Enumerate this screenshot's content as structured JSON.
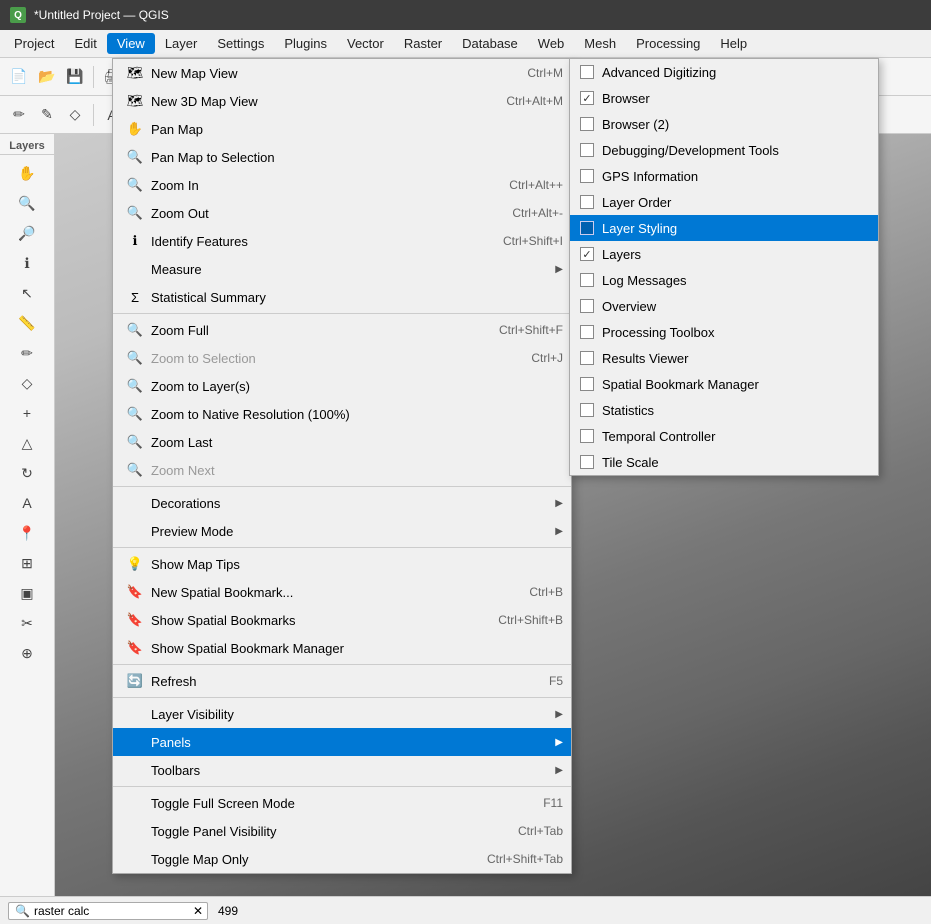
{
  "titleBar": {
    "icon": "Q",
    "title": "*Untitled Project — QGIS"
  },
  "menuBar": {
    "items": [
      {
        "id": "project",
        "label": "Project"
      },
      {
        "id": "edit",
        "label": "Edit"
      },
      {
        "id": "view",
        "label": "View",
        "active": true
      },
      {
        "id": "layer",
        "label": "Layer"
      },
      {
        "id": "settings",
        "label": "Settings"
      },
      {
        "id": "plugins",
        "label": "Plugins"
      },
      {
        "id": "vector",
        "label": "Vector"
      },
      {
        "id": "raster",
        "label": "Raster"
      },
      {
        "id": "database",
        "label": "Database"
      },
      {
        "id": "web",
        "label": "Web"
      },
      {
        "id": "mesh",
        "label": "Mesh"
      },
      {
        "id": "processing",
        "label": "Processing"
      },
      {
        "id": "help",
        "label": "Help"
      }
    ]
  },
  "viewMenu": {
    "items": [
      {
        "id": "new-map-view",
        "icon": "🗺",
        "label": "New Map View",
        "shortcut": "Ctrl+M",
        "hasArrow": false,
        "disabled": false
      },
      {
        "id": "new-3d-map-view",
        "icon": "🗺",
        "label": "New 3D Map View",
        "shortcut": "Ctrl+Alt+M",
        "hasArrow": false,
        "disabled": false
      },
      {
        "id": "pan-map",
        "icon": "✋",
        "label": "Pan Map",
        "shortcut": "",
        "hasArrow": false,
        "disabled": false
      },
      {
        "id": "pan-map-to-selection",
        "icon": "🔍",
        "label": "Pan Map to Selection",
        "shortcut": "",
        "hasArrow": false,
        "disabled": false
      },
      {
        "id": "zoom-in",
        "icon": "🔍",
        "label": "Zoom In",
        "shortcut": "Ctrl+Alt++",
        "hasArrow": false,
        "disabled": false
      },
      {
        "id": "zoom-out",
        "icon": "🔍",
        "label": "Zoom Out",
        "shortcut": "Ctrl+Alt+-",
        "hasArrow": false,
        "disabled": false
      },
      {
        "id": "identify-features",
        "icon": "ℹ",
        "label": "Identify Features",
        "shortcut": "Ctrl+Shift+I",
        "hasArrow": false,
        "disabled": false
      },
      {
        "id": "measure",
        "icon": "",
        "label": "Measure",
        "shortcut": "",
        "hasArrow": true,
        "disabled": false
      },
      {
        "id": "statistical-summary",
        "icon": "Σ",
        "label": "Statistical Summary",
        "shortcut": "",
        "hasArrow": false,
        "disabled": false
      },
      {
        "id": "sep1",
        "type": "separator"
      },
      {
        "id": "zoom-full",
        "icon": "🔍",
        "label": "Zoom Full",
        "shortcut": "Ctrl+Shift+F",
        "hasArrow": false,
        "disabled": false
      },
      {
        "id": "zoom-to-selection",
        "icon": "🔍",
        "label": "Zoom to Selection",
        "shortcut": "Ctrl+J",
        "hasArrow": false,
        "disabled": true
      },
      {
        "id": "zoom-to-layers",
        "icon": "🔍",
        "label": "Zoom to Layer(s)",
        "shortcut": "",
        "hasArrow": false,
        "disabled": false
      },
      {
        "id": "zoom-to-native",
        "icon": "🔍",
        "label": "Zoom to Native Resolution (100%)",
        "shortcut": "",
        "hasArrow": false,
        "disabled": false
      },
      {
        "id": "zoom-last",
        "icon": "🔍",
        "label": "Zoom Last",
        "shortcut": "",
        "hasArrow": false,
        "disabled": false
      },
      {
        "id": "zoom-next",
        "icon": "🔍",
        "label": "Zoom Next",
        "shortcut": "",
        "hasArrow": false,
        "disabled": true
      },
      {
        "id": "sep2",
        "type": "separator"
      },
      {
        "id": "decorations",
        "icon": "",
        "label": "Decorations",
        "shortcut": "",
        "hasArrow": true,
        "disabled": false
      },
      {
        "id": "preview-mode",
        "icon": "",
        "label": "Preview Mode",
        "shortcut": "",
        "hasArrow": true,
        "disabled": false
      },
      {
        "id": "sep3",
        "type": "separator"
      },
      {
        "id": "show-map-tips",
        "icon": "💡",
        "label": "Show Map Tips",
        "shortcut": "",
        "hasArrow": false,
        "disabled": false
      },
      {
        "id": "new-spatial-bookmark",
        "icon": "🔖",
        "label": "New Spatial Bookmark...",
        "shortcut": "Ctrl+B",
        "hasArrow": false,
        "disabled": false
      },
      {
        "id": "show-spatial-bookmarks",
        "icon": "🔖",
        "label": "Show Spatial Bookmarks",
        "shortcut": "Ctrl+Shift+B",
        "hasArrow": false,
        "disabled": false
      },
      {
        "id": "show-spatial-bookmark-manager",
        "icon": "🔖",
        "label": "Show Spatial Bookmark Manager",
        "shortcut": "",
        "hasArrow": false,
        "disabled": false
      },
      {
        "id": "sep4",
        "type": "separator"
      },
      {
        "id": "refresh",
        "icon": "🔄",
        "label": "Refresh",
        "shortcut": "F5",
        "hasArrow": false,
        "disabled": false
      },
      {
        "id": "sep5",
        "type": "separator"
      },
      {
        "id": "layer-visibility",
        "icon": "",
        "label": "Layer Visibility",
        "shortcut": "",
        "hasArrow": true,
        "disabled": false
      },
      {
        "id": "panels",
        "icon": "",
        "label": "Panels",
        "shortcut": "",
        "hasArrow": true,
        "disabled": false,
        "active": true
      },
      {
        "id": "toolbars",
        "icon": "",
        "label": "Toolbars",
        "shortcut": "",
        "hasArrow": true,
        "disabled": false
      },
      {
        "id": "sep6",
        "type": "separator"
      },
      {
        "id": "toggle-fullscreen",
        "icon": "",
        "label": "Toggle Full Screen Mode",
        "shortcut": "F11",
        "hasArrow": false,
        "disabled": false
      },
      {
        "id": "toggle-panel-visibility",
        "icon": "",
        "label": "Toggle Panel Visibility",
        "shortcut": "Ctrl+Tab",
        "hasArrow": false,
        "disabled": false
      },
      {
        "id": "toggle-map-only",
        "icon": "",
        "label": "Toggle Map Only",
        "shortcut": "Ctrl+Shift+Tab",
        "hasArrow": false,
        "disabled": false
      }
    ]
  },
  "panelsSubmenu": {
    "items": [
      {
        "id": "advanced-digitizing",
        "label": "Advanced Digitizing",
        "checked": false,
        "highlighted": false
      },
      {
        "id": "browser",
        "label": "Browser",
        "checked": true,
        "highlighted": false
      },
      {
        "id": "browser2",
        "label": "Browser (2)",
        "checked": false,
        "highlighted": false
      },
      {
        "id": "debugging",
        "label": "Debugging/Development Tools",
        "checked": false,
        "highlighted": false
      },
      {
        "id": "gps-information",
        "label": "GPS Information",
        "checked": false,
        "highlighted": false
      },
      {
        "id": "layer-order",
        "label": "Layer Order",
        "checked": false,
        "highlighted": false
      },
      {
        "id": "layer-styling",
        "label": "Layer Styling",
        "checked": false,
        "highlighted": true
      },
      {
        "id": "layers",
        "label": "Layers",
        "checked": true,
        "highlighted": false
      },
      {
        "id": "log-messages",
        "label": "Log Messages",
        "checked": false,
        "highlighted": false
      },
      {
        "id": "overview",
        "label": "Overview",
        "checked": false,
        "highlighted": false
      },
      {
        "id": "processing-toolbox",
        "label": "Processing Toolbox",
        "checked": false,
        "highlighted": false
      },
      {
        "id": "results-viewer",
        "label": "Results Viewer",
        "checked": false,
        "highlighted": false
      },
      {
        "id": "spatial-bookmark-manager",
        "label": "Spatial Bookmark Manager",
        "checked": false,
        "highlighted": false
      },
      {
        "id": "statistics",
        "label": "Statistics",
        "checked": false,
        "highlighted": false
      },
      {
        "id": "temporal-controller",
        "label": "Temporal Controller",
        "checked": false,
        "highlighted": false
      },
      {
        "id": "tile-scale",
        "label": "Tile Scale",
        "checked": false,
        "highlighted": false
      }
    ]
  },
  "statusBar": {
    "searchPlaceholder": "raster calc",
    "coordinates": "499"
  },
  "layersPanel": {
    "title": "Layers"
  }
}
